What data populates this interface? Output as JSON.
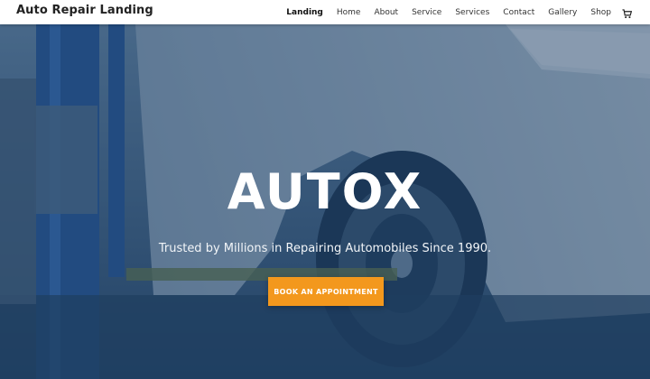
{
  "header": {
    "site_title": "Auto Repair Landing",
    "nav": [
      {
        "label": "Landing",
        "active": true
      },
      {
        "label": "Home"
      },
      {
        "label": "About"
      },
      {
        "label": "Service"
      },
      {
        "label": "Services"
      },
      {
        "label": "Contact"
      },
      {
        "label": "Gallery"
      },
      {
        "label": "Shop"
      }
    ],
    "cart_icon": "shopping-cart-icon"
  },
  "hero": {
    "title": "AUTOX",
    "subtitle": "Trusted by Millions in Repairing Automobiles Since 1990.",
    "cta_label": "BOOK AN APPOINTMENT",
    "accent_color": "#f3981d",
    "overlay_color": "#1d3f63"
  }
}
